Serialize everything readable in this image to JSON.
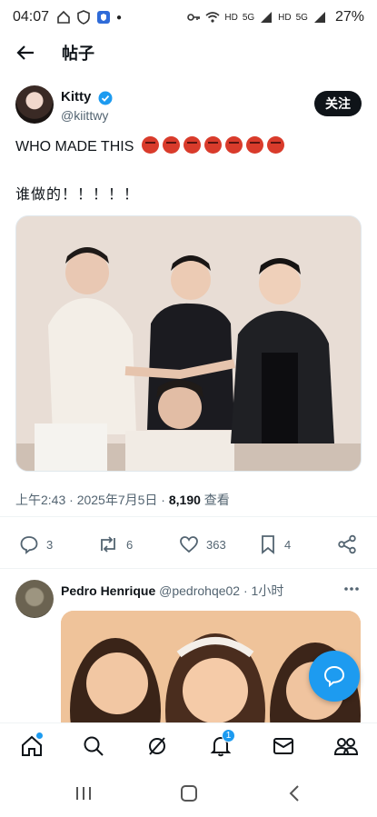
{
  "status_bar": {
    "time": "04:07",
    "hd1": "HD",
    "net1": "5G",
    "hd2": "HD",
    "net2": "5G",
    "battery": "27%"
  },
  "topbar": {
    "title": "帖子"
  },
  "post": {
    "author_name": "Kitty",
    "author_handle": "@kiittwy",
    "follow_label": "关注",
    "text_line1": "WHO MADE THIS",
    "emoji_count": 7,
    "text_line2": "谁做的！！！！！",
    "timestamp": "上午2:43 · 2025年7月5日 · ",
    "views_count": "8,190",
    "views_label": " 查看",
    "replies": "3",
    "reposts": "6",
    "likes": "363",
    "bookmarks": "4"
  },
  "reply": {
    "name": "Pedro Henrique",
    "handle": "@pedrohqe02",
    "time": " · 1小时"
  },
  "bottom_nav": {
    "notification_badge": "1"
  },
  "colors": {
    "accent": "#1d9bf0",
    "text": "#0f1419",
    "muted": "#536471"
  }
}
